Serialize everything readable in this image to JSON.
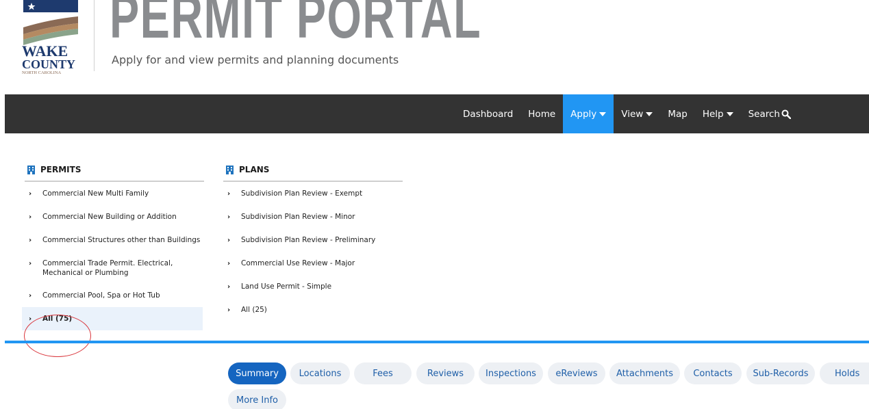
{
  "header": {
    "county_logo_text": "WAKE COUNTY NORTH CAROLINA",
    "title": "PERMIT PORTAL",
    "subtitle": "Apply for and view permits and planning documents"
  },
  "nav": {
    "items": [
      {
        "label": "Dashboard",
        "icon": null
      },
      {
        "label": "Home",
        "icon": null
      },
      {
        "label": "Apply",
        "icon": "caret-down-icon",
        "active": true
      },
      {
        "label": "View",
        "icon": "caret-down-icon"
      },
      {
        "label": "Map",
        "icon": null
      },
      {
        "label": "Help",
        "icon": "caret-down-icon"
      },
      {
        "label": "Search",
        "icon": "search-icon"
      }
    ]
  },
  "permits": {
    "heading": "PERMITS",
    "items": [
      "Commercial New Multi Family",
      "Commercial New Building or Addition",
      "Commercial Structures other than Buildings",
      "Commercial Trade Permit. Electrical, Mechanical or Plumbing",
      "Commercial Pool, Spa or Hot Tub",
      "All (75)"
    ]
  },
  "plans": {
    "heading": "PLANS",
    "items": [
      "Subdivision Plan Review - Exempt",
      "Subdivision Plan Review - Minor",
      "Subdivision Plan Review - Preliminary",
      "Commercial Use Review - Major",
      "Land Use Permit - Simple",
      "All (25)"
    ]
  },
  "tabs": {
    "items": [
      "Summary",
      "Locations",
      "Fees",
      "Reviews",
      "Inspections",
      "eReviews",
      "Attachments",
      "Contacts",
      "Sub-Records",
      "Holds",
      "More Info"
    ],
    "active": "Summary"
  },
  "colors": {
    "navbar_bg": "#333333",
    "nav_active": "#2196f3",
    "tab_active": "#1565c0",
    "tab_text": "#1f5fa8",
    "annotation_circle": "#d9343a"
  }
}
